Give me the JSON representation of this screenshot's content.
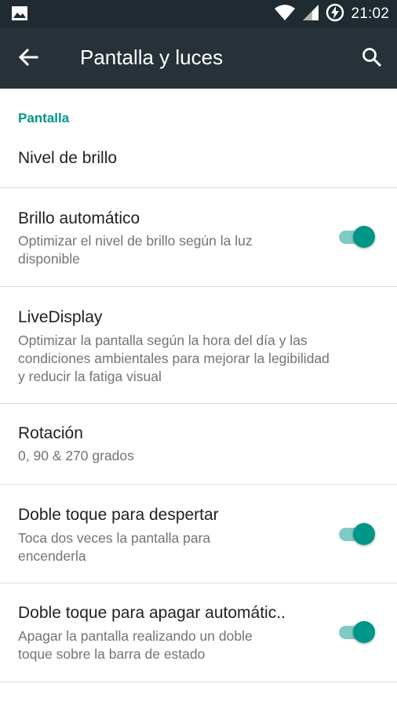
{
  "status_bar": {
    "time": "21:02",
    "icons": [
      "image-icon",
      "wifi-icon",
      "signal-icon",
      "battery-charging-icon"
    ]
  },
  "app_bar": {
    "title": "Pantalla y luces",
    "icons": [
      "arrow-back-icon",
      "search-icon"
    ]
  },
  "category": "Pantalla",
  "preferences": [
    {
      "title": "Nivel de brillo",
      "summary": "",
      "switch": null
    },
    {
      "title": "Brillo automático",
      "summary_lines": [
        "Optimizar el nivel de brillo según la luz",
        "disponible"
      ],
      "switch": true
    },
    {
      "title": "LiveDisplay",
      "summary_lines": [
        "Optimizar la pantalla según la hora del día y las",
        "condiciones ambientales para mejorar la legibilidad",
        "y reducir la fatiga visual"
      ],
      "switch": null
    },
    {
      "title": "Rotación",
      "summary_lines": [
        "0, 90 & 270 grados"
      ],
      "switch": null
    },
    {
      "title": "Doble toque para despertar",
      "summary_lines": [
        "Toca dos veces la pantalla para",
        "encenderla"
      ],
      "switch": true
    },
    {
      "title": "Doble toque para apagar automátic..",
      "summary_lines": [
        "Apagar la pantalla realizando un doble",
        "toque sobre la barra de estado"
      ],
      "switch": true
    }
  ],
  "colors": {
    "status_bar": "#1f2b31",
    "app_bar": "#263238",
    "accent": "#009688",
    "switch_track": "#80cbc4"
  }
}
